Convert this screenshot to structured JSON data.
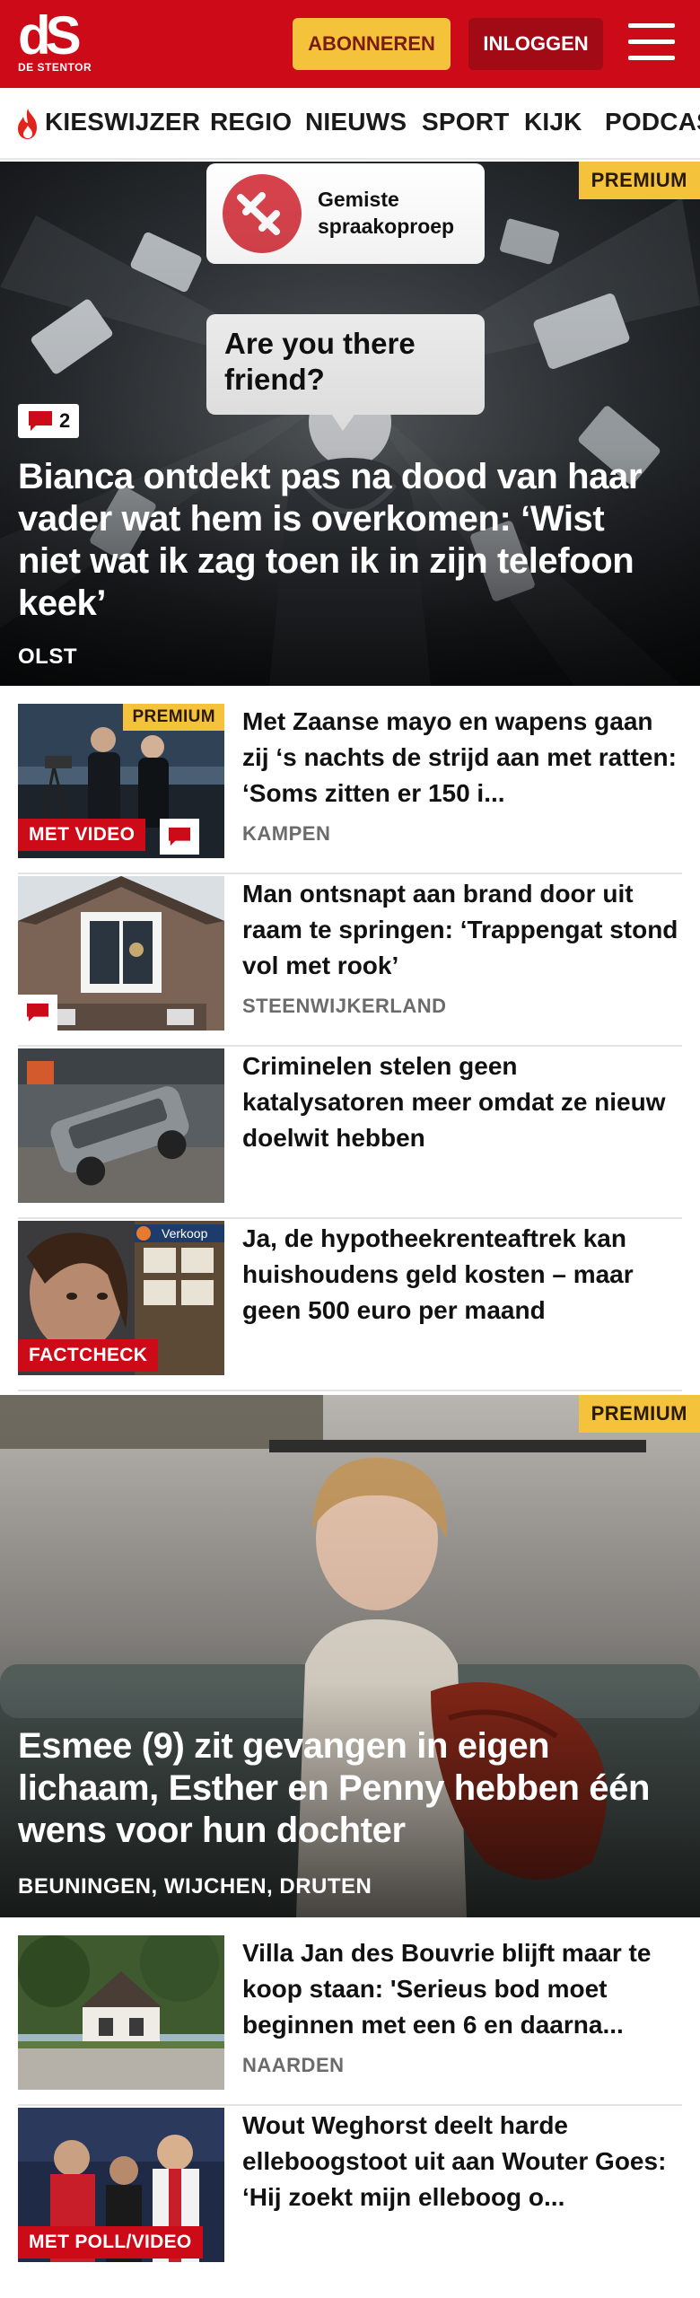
{
  "header": {
    "logo_mark": "dS",
    "logo_sub": "DE STENTOR",
    "subscribe_label": "ABONNEREN",
    "login_label": "INLOGGEN",
    "menu_icon": "hamburger-menu-icon"
  },
  "nav": {
    "items": [
      "KIESWIJZER",
      "REGIO",
      "NIEUWS",
      "SPORT",
      "KIJK",
      "PODCAS"
    ]
  },
  "hero1": {
    "badge": "PREMIUM",
    "image_text_top": "Gemiste spraakoproep",
    "image_text_bubble": "Are you there friend?",
    "comments": "2",
    "title": "Bianca ontdekt pas na dood van haar vader wat hem is overkomen: ‘Wist niet wat ik zag toen ik in zijn telefoon keek’",
    "location": "OLST"
  },
  "articles1": [
    {
      "title": "Met Zaanse mayo en wapens gaan zij ‘s nachts de strijd aan met ratten: ‘Soms zitten er 150 i...",
      "location": "KAMPEN",
      "premium": "PREMIUM",
      "tag": "MET VIDEO"
    },
    {
      "title": "Man ontsnapt aan brand door uit raam te springen: ‘Trappengat stond vol met rook’",
      "location": "STEENWIJKERLAND"
    },
    {
      "title": "Criminelen stelen geen katalysatoren meer omdat ze nieuw doelwit hebben",
      "location": ""
    },
    {
      "title": "Ja, de hypotheekrenteaftrek kan huishoudens geld kosten – maar geen 500 euro per maand",
      "location": "",
      "tag": "FACTCHECK",
      "thumb_sign": "Verkoop"
    }
  ],
  "hero2": {
    "badge": "PREMIUM",
    "title": "Esmee (9) zit gevangen in eigen lichaam, Esther en Penny hebben één wens voor hun dochter",
    "location": "BEUNINGEN, WIJCHEN, DRUTEN"
  },
  "articles2": [
    {
      "title": "Villa Jan des Bouvrie blijft maar te koop staan: 'Serieus bod moet beginnen met een 6 en daarna...",
      "location": "NAARDEN"
    },
    {
      "title": "Wout Weghorst deelt harde elleboogstoot uit aan Wouter Goes: ‘Hij zoekt mijn elleboog o...",
      "location": "",
      "tag": "MET POLL/VIDEO"
    }
  ],
  "colors": {
    "brand_red": "#cc0a18",
    "premium_yellow": "#f5c33b",
    "login_dark_red": "#a20a15"
  }
}
